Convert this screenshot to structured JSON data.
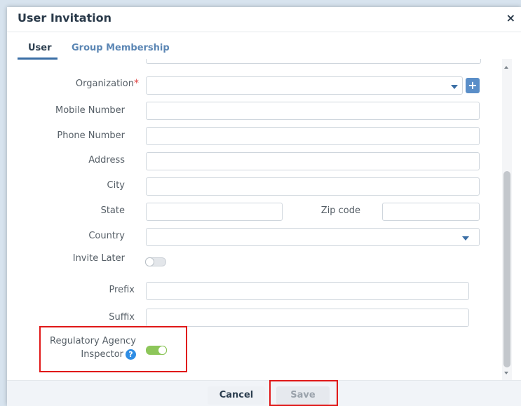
{
  "dialog": {
    "title": "User Invitation",
    "close_label": "×"
  },
  "tabs": {
    "user": "User",
    "group": "Group Membership"
  },
  "form": {
    "organization_label": "Organization",
    "required_mark": "*",
    "organization_value": "",
    "mobile_label": "Mobile Number",
    "mobile_value": "",
    "phone_label": "Phone Number",
    "phone_value": "",
    "address_label": "Address",
    "address_value": "",
    "city_label": "City",
    "city_value": "",
    "state_label": "State",
    "state_value": "",
    "zip_label": "Zip code",
    "zip_value": "",
    "country_label": "Country",
    "country_value": "",
    "invite_later_label": "Invite Later",
    "invite_later_on": false,
    "prefix_label": "Prefix",
    "prefix_value": "",
    "suffix_label": "Suffix",
    "suffix_value": "",
    "regulatory_line1": "Regulatory Agency",
    "regulatory_line2": "Inspector",
    "regulatory_on": true,
    "help_glyph": "?",
    "plus_glyph": "+"
  },
  "footer": {
    "cancel_label": "Cancel",
    "save_label": "Save"
  },
  "colors": {
    "accent": "#3a6ea5",
    "toggle_on": "#8dc65a",
    "required": "#e04848",
    "highlight": "#e01818",
    "help": "#2f8de4"
  }
}
